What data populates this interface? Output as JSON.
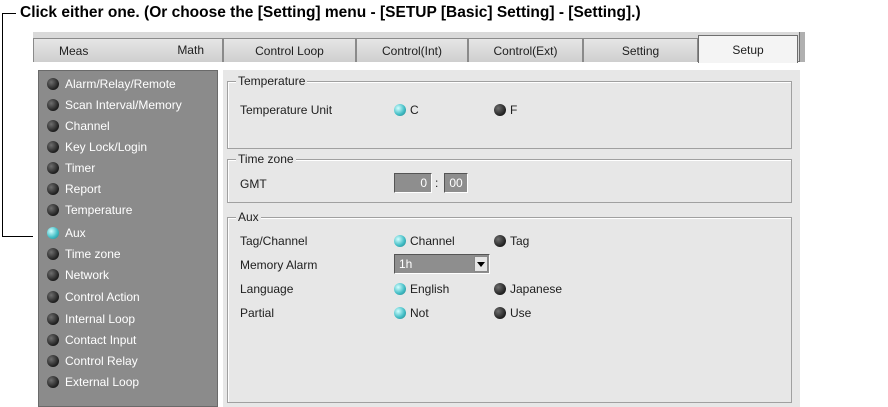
{
  "instruction": "Click either one. (Or choose the [Setting] menu - [SETUP [Basic] Setting] - [Setting].)",
  "tabs": [
    {
      "label": "Meas"
    },
    {
      "label": "Math"
    },
    {
      "label": "Control Loop"
    },
    {
      "label": "Control(Int)"
    },
    {
      "label": "Control(Ext)"
    },
    {
      "label": "Setting"
    },
    {
      "label": "Setup",
      "active": true
    }
  ],
  "sidebar": {
    "items": [
      {
        "label": "Alarm/Relay/Remote"
      },
      {
        "label": "Scan Interval/Memory"
      },
      {
        "label": "Channel"
      },
      {
        "label": "Key Lock/Login"
      },
      {
        "label": "Timer"
      },
      {
        "label": "Report"
      },
      {
        "label": "Temperature"
      },
      {
        "label": "Aux",
        "active": true
      },
      {
        "label": "Time zone"
      },
      {
        "label": "Network"
      },
      {
        "label": "Control Action"
      },
      {
        "label": "Internal Loop"
      },
      {
        "label": "Contact Input"
      },
      {
        "label": "Control Relay"
      },
      {
        "label": "External Loop"
      }
    ]
  },
  "temperature": {
    "title": "Temperature",
    "unit_label": "Temperature Unit",
    "options": [
      {
        "label": "C",
        "selected": true
      },
      {
        "label": "F",
        "selected": false
      }
    ]
  },
  "timezone": {
    "title": "Time zone",
    "gmt_label": "GMT",
    "hours": "0",
    "separator": ":",
    "minutes": "00"
  },
  "aux": {
    "title": "Aux",
    "tag_channel_label": "Tag/Channel",
    "tag_channel_options": [
      {
        "label": "Channel",
        "selected": true
      },
      {
        "label": "Tag",
        "selected": false
      }
    ],
    "memory_alarm_label": "Memory Alarm",
    "memory_alarm_value": "1h",
    "language_label": "Language",
    "language_options": [
      {
        "label": "English",
        "selected": true
      },
      {
        "label": "Japanese",
        "selected": false
      }
    ],
    "partial_label": "Partial",
    "partial_options": [
      {
        "label": "Not",
        "selected": true
      },
      {
        "label": "Use",
        "selected": false
      }
    ]
  },
  "colors": {
    "selected_indicator": "#45bfc7",
    "unselected_indicator": "#1e1e1e",
    "sidebar_bg": "#8b8b8b",
    "content_bg": "#e7e7e7"
  }
}
